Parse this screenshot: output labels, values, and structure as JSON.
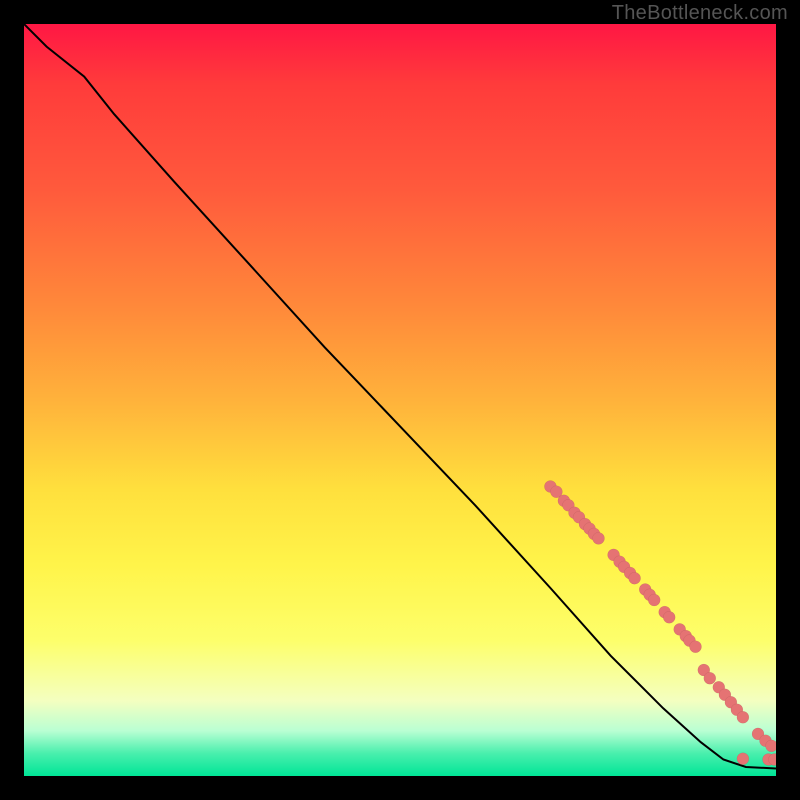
{
  "watermark": "TheBottleneck.com",
  "chart_data": {
    "type": "line",
    "title": "",
    "xlabel": "",
    "ylabel": "",
    "xlim": [
      0,
      100
    ],
    "ylim": [
      0,
      100
    ],
    "curve": [
      {
        "x": 0,
        "y": 100
      },
      {
        "x": 3,
        "y": 97
      },
      {
        "x": 8,
        "y": 93
      },
      {
        "x": 12,
        "y": 88
      },
      {
        "x": 20,
        "y": 79
      },
      {
        "x": 30,
        "y": 68
      },
      {
        "x": 40,
        "y": 57
      },
      {
        "x": 50,
        "y": 46.5
      },
      {
        "x": 60,
        "y": 36
      },
      {
        "x": 70,
        "y": 25
      },
      {
        "x": 78,
        "y": 16
      },
      {
        "x": 85,
        "y": 9
      },
      {
        "x": 90,
        "y": 4.5
      },
      {
        "x": 93,
        "y": 2.2
      },
      {
        "x": 96,
        "y": 1.2
      },
      {
        "x": 100,
        "y": 1.0
      }
    ],
    "scatter": [
      {
        "x": 70.0,
        "y": 38.5
      },
      {
        "x": 70.8,
        "y": 37.8
      },
      {
        "x": 71.8,
        "y": 36.6
      },
      {
        "x": 72.4,
        "y": 36.0
      },
      {
        "x": 73.2,
        "y": 35.0
      },
      {
        "x": 73.8,
        "y": 34.4
      },
      {
        "x": 74.6,
        "y": 33.5
      },
      {
        "x": 75.2,
        "y": 32.9
      },
      {
        "x": 75.8,
        "y": 32.2
      },
      {
        "x": 76.4,
        "y": 31.6
      },
      {
        "x": 78.4,
        "y": 29.4
      },
      {
        "x": 79.2,
        "y": 28.5
      },
      {
        "x": 79.8,
        "y": 27.8
      },
      {
        "x": 80.6,
        "y": 27.0
      },
      {
        "x": 81.2,
        "y": 26.3
      },
      {
        "x": 82.6,
        "y": 24.8
      },
      {
        "x": 83.2,
        "y": 24.1
      },
      {
        "x": 83.8,
        "y": 23.4
      },
      {
        "x": 85.2,
        "y": 21.8
      },
      {
        "x": 85.8,
        "y": 21.1
      },
      {
        "x": 87.2,
        "y": 19.5
      },
      {
        "x": 88.0,
        "y": 18.6
      },
      {
        "x": 88.5,
        "y": 18.0
      },
      {
        "x": 89.3,
        "y": 17.2
      },
      {
        "x": 90.4,
        "y": 14.1
      },
      {
        "x": 91.2,
        "y": 13.0
      },
      {
        "x": 92.4,
        "y": 11.8
      },
      {
        "x": 93.2,
        "y": 10.8
      },
      {
        "x": 94.0,
        "y": 9.8
      },
      {
        "x": 94.8,
        "y": 8.8
      },
      {
        "x": 95.6,
        "y": 7.8
      },
      {
        "x": 97.6,
        "y": 5.6
      },
      {
        "x": 98.6,
        "y": 4.7
      },
      {
        "x": 99.4,
        "y": 4.0
      },
      {
        "x": 95.6,
        "y": 2.3
      },
      {
        "x": 99.0,
        "y": 2.2
      },
      {
        "x": 99.8,
        "y": 2.2
      }
    ],
    "colors": {
      "curve": "#000000",
      "dot": "#e57373",
      "gradient_top": "#ff1744",
      "gradient_mid": "#ffe03d",
      "gradient_bot": "#00e597"
    }
  }
}
